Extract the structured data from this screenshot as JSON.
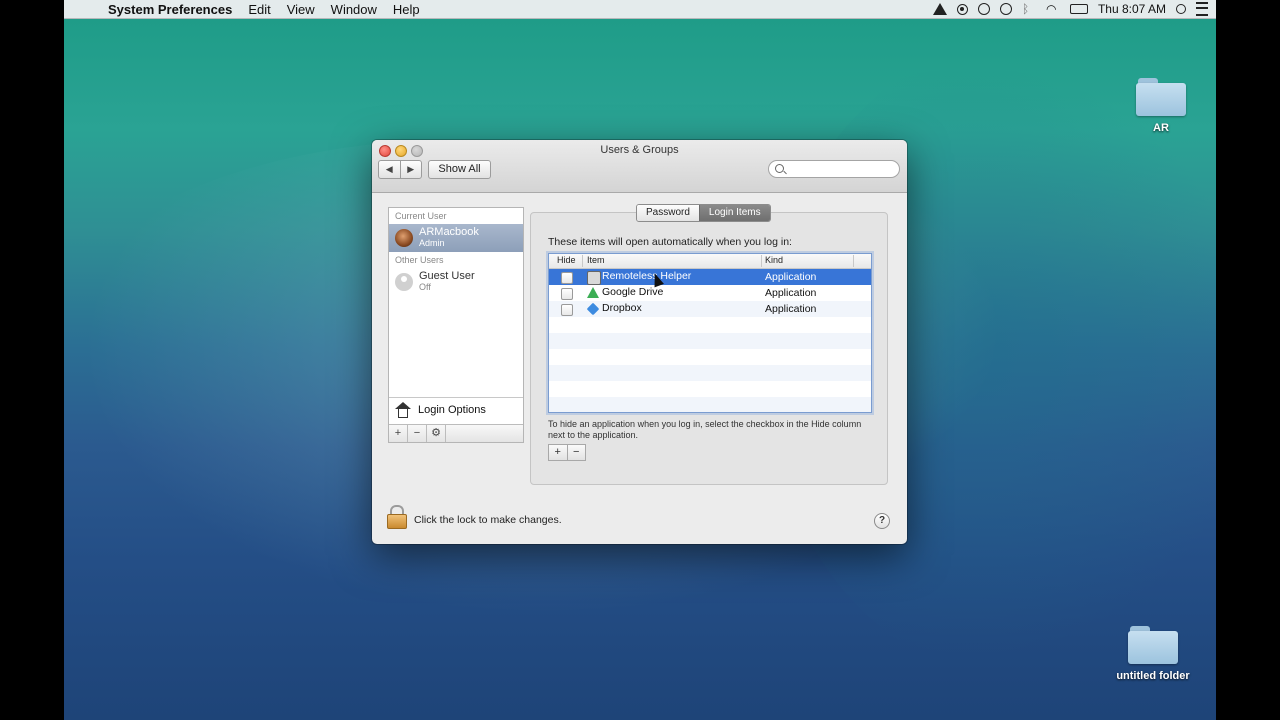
{
  "menubar": {
    "app_name": "System Preferences",
    "menus": [
      "Edit",
      "View",
      "Window",
      "Help"
    ],
    "clock": "Thu 8:07 AM"
  },
  "desktop": {
    "icons": [
      {
        "label": "AR",
        "icon": "folder-icon"
      },
      {
        "label": "untitled folder",
        "icon": "folder-icon"
      }
    ]
  },
  "window": {
    "title": "Users & Groups",
    "show_all_label": "Show All",
    "search_placeholder": ""
  },
  "sidebar": {
    "current_user_label": "Current User",
    "current_user": {
      "name": "ARMacbook",
      "role": "Admin"
    },
    "other_users_label": "Other Users",
    "other_users": [
      {
        "name": "Guest User",
        "status": "Off"
      }
    ],
    "login_options_label": "Login Options"
  },
  "tabs": [
    {
      "label": "Password",
      "active": false
    },
    {
      "label": "Login Items",
      "active": true
    }
  ],
  "login_items": {
    "intro": "These items will open automatically when you log in:",
    "columns": [
      "Hide",
      "Item",
      "Kind"
    ],
    "rows": [
      {
        "item": "Remoteless Helper",
        "kind": "Application",
        "hide": false,
        "selected": true,
        "icon": "remote-icon"
      },
      {
        "item": "Google Drive",
        "kind": "Application",
        "hide": false,
        "selected": false,
        "icon": "google-drive-icon"
      },
      {
        "item": "Dropbox",
        "kind": "Application",
        "hide": false,
        "selected": false,
        "icon": "dropbox-icon"
      }
    ],
    "help_text": "To hide an application when you log in, select the checkbox in the Hide column next to the application."
  },
  "footer": {
    "lock_text": "Click the lock to make changes.",
    "help_label": "?"
  },
  "colors": {
    "selection": "#3875d7",
    "sidebar_selection": "#8d9fb9"
  }
}
